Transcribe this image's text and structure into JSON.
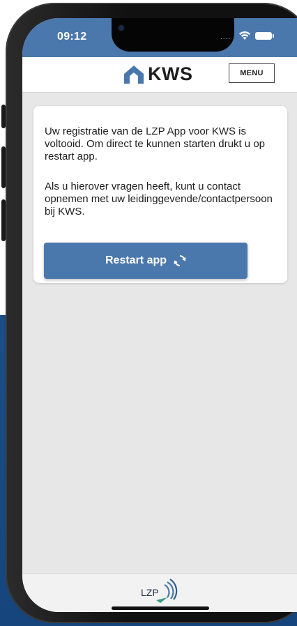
{
  "status_bar": {
    "time": "09:12",
    "signal_indicator": "....",
    "wifi_icon": "wifi-icon",
    "battery_icon": "battery-icon"
  },
  "header": {
    "logo_text": "KWS",
    "menu_label": "MENU"
  },
  "card": {
    "paragraph_1": "Uw registratie van de LZP App voor KWS is voltooid. Om direct te kunnen starten drukt u op restart app.",
    "paragraph_2": "Als u hierover vragen heeft, kunt u contact opnemen met uw leidinggevende/contactpersoon bij KWS.",
    "restart_label": "Restart app",
    "restart_icon": "refresh-icon"
  },
  "footer": {
    "logo_text": "LZP"
  },
  "colors": {
    "accent": "#4a78ad",
    "background_panel": "#1b4d86",
    "screen_background": "#e7e7e7"
  }
}
